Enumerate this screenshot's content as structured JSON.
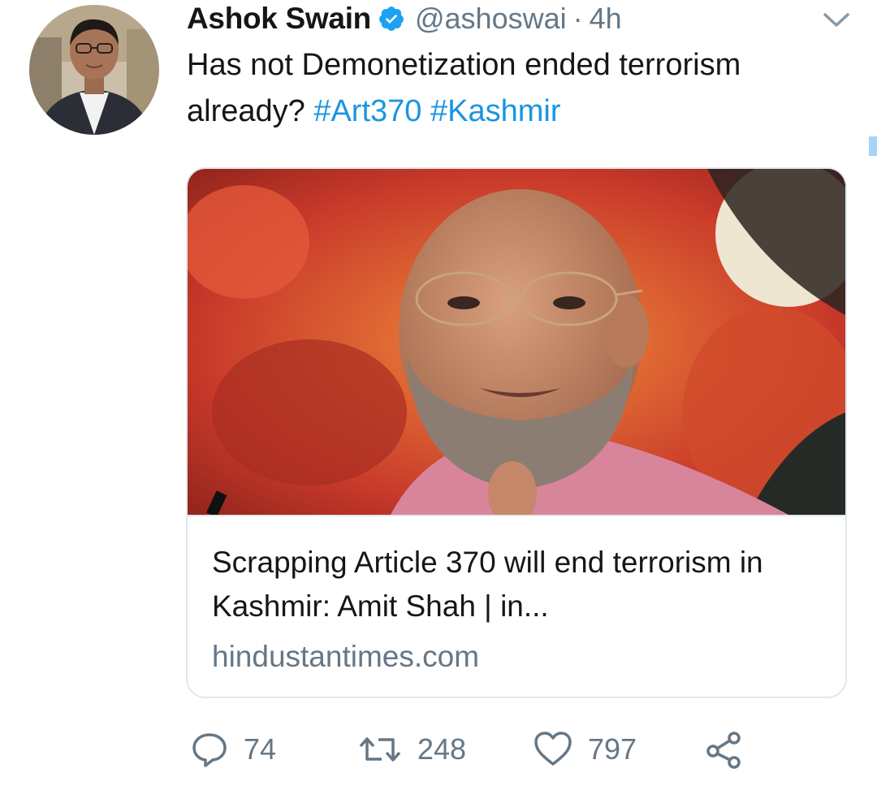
{
  "author": {
    "display_name": "Ashok Swain",
    "handle": "@ashoswai",
    "separator": "·",
    "time": "4h",
    "verified": true
  },
  "tweet": {
    "text_before": "Has not Demonetization ended terrorism already? ",
    "hashtags": [
      "#Art370",
      "#Kashmir"
    ]
  },
  "card": {
    "title": "Scrapping Article 370 will end terrorism in Kashmir: Amit Shah | in...",
    "domain": "hindustantimes.com"
  },
  "actions": {
    "replies": "74",
    "retweets": "248",
    "likes": "797"
  },
  "icons": {
    "verified": "verified-badge-icon",
    "caret": "chevron-down-icon",
    "reply": "reply-icon",
    "retweet": "retweet-icon",
    "like": "heart-icon",
    "share": "share-icon"
  },
  "colors": {
    "link": "#1b95e0",
    "verified": "#1da1f2",
    "secondary_text": "#657786",
    "primary_text": "#14171a",
    "border": "#e1e8ed"
  }
}
